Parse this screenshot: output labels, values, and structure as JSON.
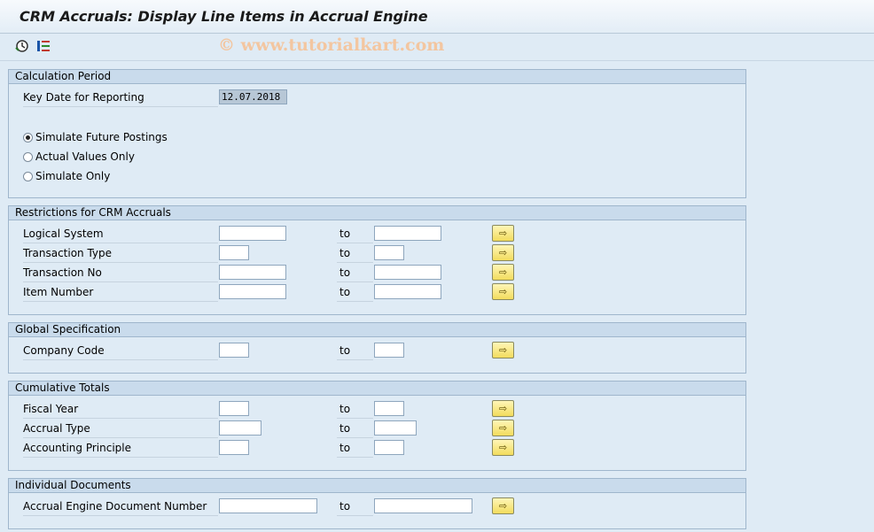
{
  "title": "CRM Accruals: Display Line Items in Accrual Engine",
  "watermark": "© www.tutorialkart.com",
  "toolbar": {
    "icons": [
      "execute-icon",
      "variant-icon"
    ]
  },
  "groups": {
    "calc_period": {
      "title": "Calculation Period",
      "key_date_label": "Key Date for Reporting",
      "key_date_value": "12.07.2018",
      "radios": [
        {
          "label": "Simulate Future Postings",
          "selected": true
        },
        {
          "label": "Actual Values Only",
          "selected": false
        },
        {
          "label": "Simulate Only",
          "selected": false
        }
      ]
    },
    "restrictions": {
      "title": "Restrictions for CRM Accruals",
      "rows": [
        {
          "label": "Logical System",
          "to": "to"
        },
        {
          "label": "Transaction Type",
          "to": "to"
        },
        {
          "label": "Transaction No",
          "to": "to"
        },
        {
          "label": "Item Number",
          "to": "to"
        }
      ]
    },
    "global": {
      "title": "Global Specification",
      "rows": [
        {
          "label": "Company Code",
          "to": "to"
        }
      ]
    },
    "cumulative": {
      "title": "Cumulative Totals",
      "rows": [
        {
          "label": "Fiscal Year",
          "to": "to"
        },
        {
          "label": "Accrual Type",
          "to": "to"
        },
        {
          "label": "Accounting Principle",
          "to": "to"
        }
      ]
    },
    "individual": {
      "title": "Individual Documents",
      "rows": [
        {
          "label": "Accrual Engine Document Number",
          "to": "to"
        }
      ]
    }
  },
  "multisel_glyph": "⇨"
}
